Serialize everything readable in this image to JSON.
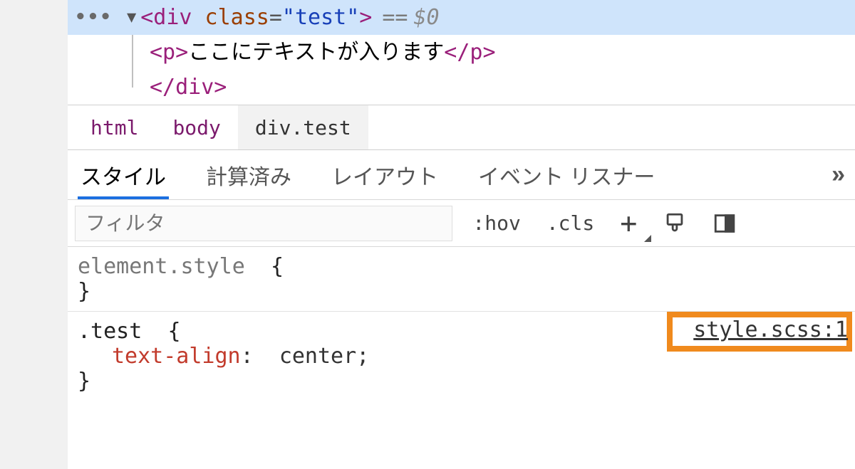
{
  "dom": {
    "selected": {
      "open_angle": "<",
      "tag": "div",
      "attr_name": "class",
      "eq": "=",
      "attr_value": "\"test\"",
      "close_angle": ">",
      "eq_marker": "==",
      "var": "$0"
    },
    "child": {
      "open": "<p>",
      "text": "ここにテキストが入ります",
      "close": "</p>"
    },
    "close_tag": "</div>"
  },
  "crumbs": [
    "html",
    "body",
    "div.test"
  ],
  "active_crumb": 2,
  "subtabs": [
    "スタイル",
    "計算済み",
    "レイアウト",
    "イベント リスナー"
  ],
  "active_subtab": 0,
  "more_chevron": "»",
  "toolbar": {
    "filter_placeholder": "フィルタ",
    "hov": ":hov",
    "cls": ".cls",
    "plus": "+"
  },
  "rules": {
    "element_style": {
      "selector": "element.style",
      "open": "{",
      "close": "}"
    },
    "test": {
      "selector": ".test",
      "open": "{",
      "prop": "text-align",
      "colon": ":",
      "val": "center",
      "semi": ";",
      "close": "}",
      "source": "style.scss:1"
    }
  }
}
